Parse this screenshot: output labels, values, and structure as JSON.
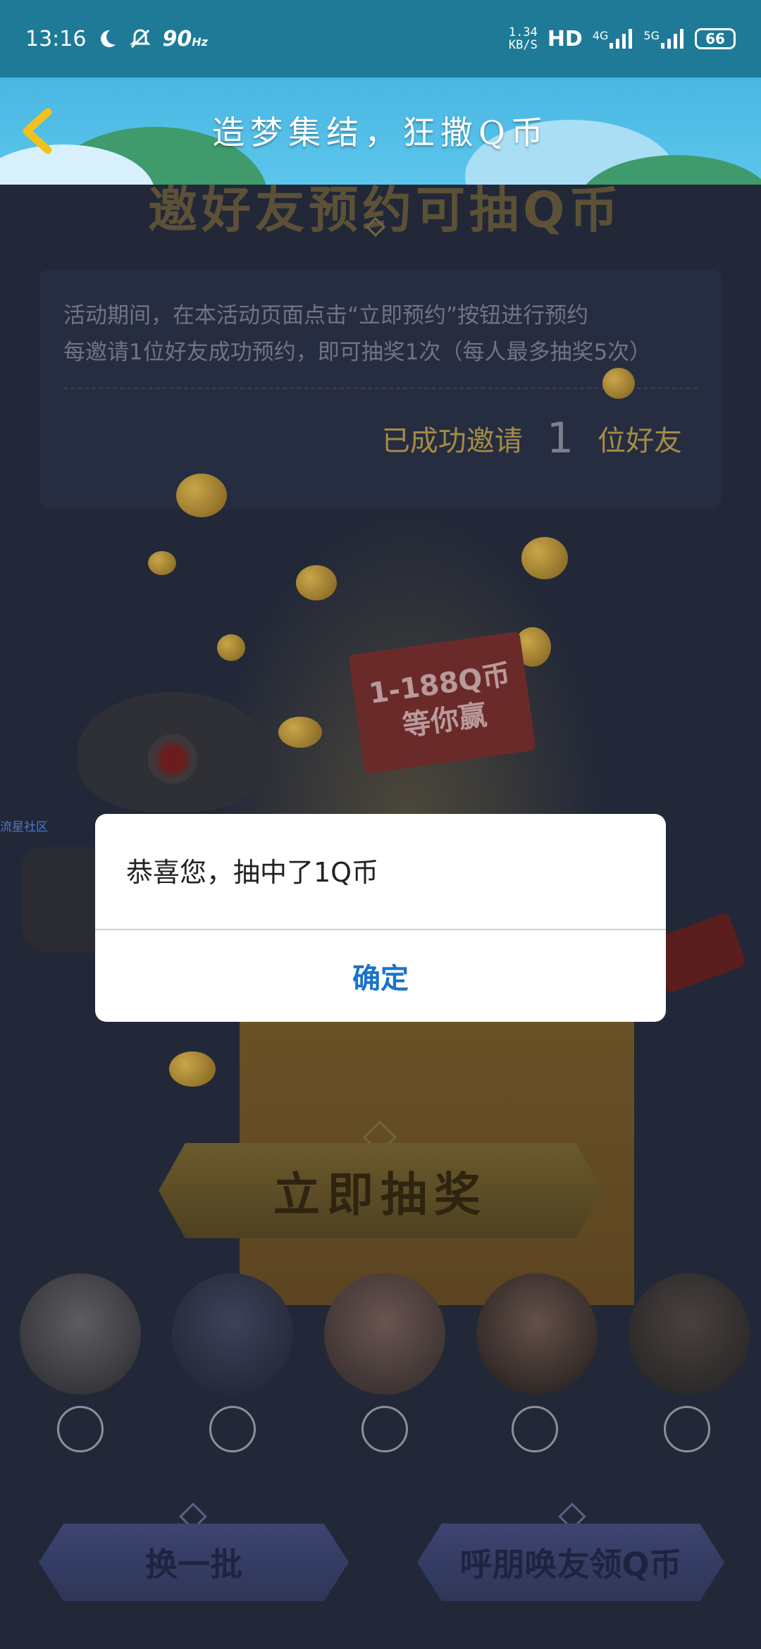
{
  "status_bar": {
    "time": "13:16",
    "refresh_rate": "90",
    "refresh_unit": "Hz",
    "net_speed_value": "1.34",
    "net_speed_unit": "KB/S",
    "hd_label": "HD",
    "network_4g": "4G",
    "network_5g": "5G",
    "battery": "66"
  },
  "header": {
    "title": "造梦集结，狂撒Q币",
    "back_icon": "chevron-left-icon"
  },
  "activity": {
    "partial_heading": "邀好友预约可抽Q币",
    "rule_line_1": "活动期间，在本活动页面点击“立即预约”按钮进行预约",
    "rule_line_2": "每邀请1位好友成功预约，即可抽奖1次（每人最多抽奖5次）",
    "invited_prefix": "已成功邀请",
    "invited_count": "1",
    "invited_suffix": "位好友",
    "prize_banner_line_1": "1-188Q币",
    "prize_banner_line_2": "等你赢",
    "side_tag": "流星社区"
  },
  "actions": {
    "draw_label": "立即抽奖",
    "swap_label": "换一批",
    "call_friends_label": "呼朋唤友领Q币"
  },
  "friends": [
    {
      "avatar": "avatar-anime-girl"
    },
    {
      "avatar": "avatar-anime-boy"
    },
    {
      "avatar": "avatar-bald-man"
    },
    {
      "avatar": "avatar-girl-photo"
    },
    {
      "avatar": "avatar-dark-photo"
    }
  ],
  "dialog": {
    "message": "恭喜您，抽中了1Q币",
    "ok_label": "确定"
  },
  "colors": {
    "status_bar": "#1e7a97",
    "title_bar": "#4ab8e4",
    "dialog_accent": "#1a73c9",
    "overlay_bg": "#222838"
  }
}
